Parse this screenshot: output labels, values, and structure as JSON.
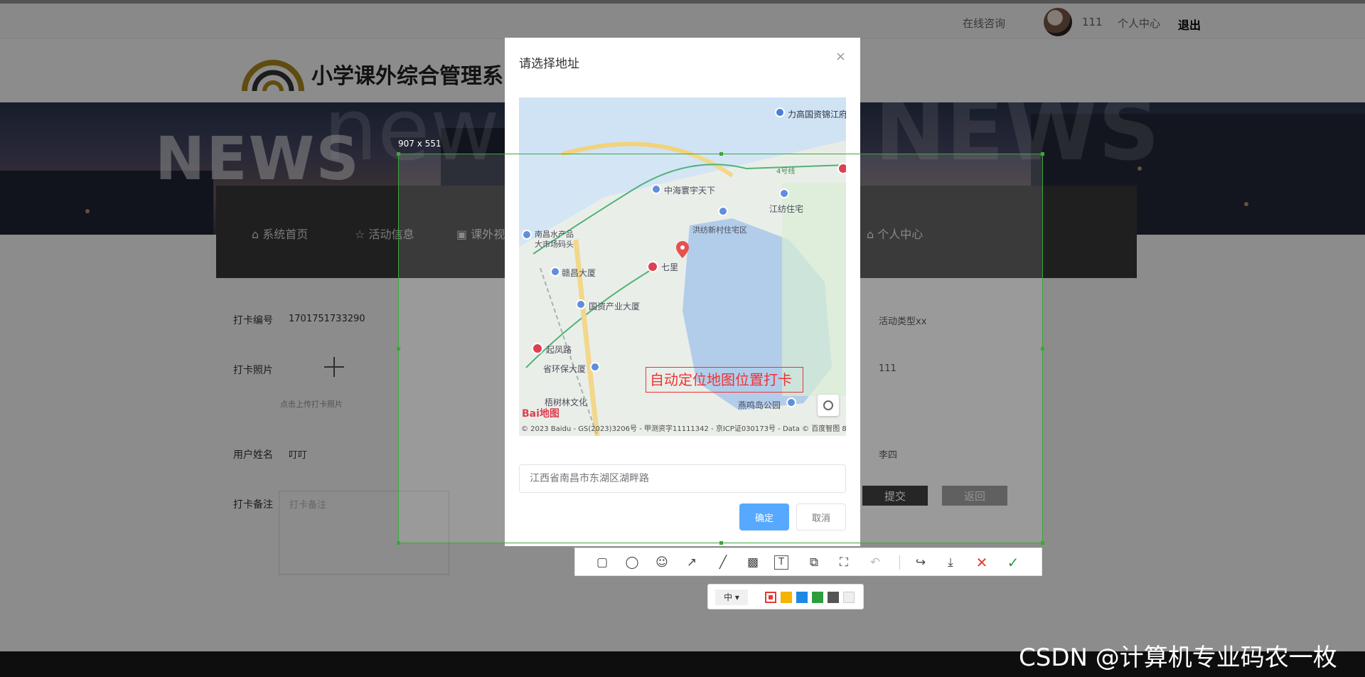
{
  "topbar": {
    "consult": "在线咨询",
    "username": "111",
    "user_center": "个人中心",
    "logout": "退出"
  },
  "site": {
    "title": "小学课外综合管理系"
  },
  "banner": {
    "word1": "NEWS",
    "word2": "new",
    "word3": "NEWS"
  },
  "nav": {
    "items": [
      {
        "icon": "home-icon",
        "label": "系统首页"
      },
      {
        "icon": "star-icon",
        "label": "活动信息"
      },
      {
        "icon": "bag-icon",
        "label": "课外视"
      },
      {
        "icon": "home-icon",
        "label": "个人中心"
      }
    ]
  },
  "form": {
    "card_no_label": "打卡编号",
    "card_no_value": "1701751733290",
    "photo_label": "打卡照片",
    "photo_hint": "点击上传打卡照片",
    "user_label": "用户姓名",
    "user_value": "叮叮",
    "note_label": "打卡备注",
    "note_placeholder": "打卡备注",
    "activity_type": "活动类型xx",
    "right_value2": "111",
    "right_value3": "李四",
    "submit": "提交",
    "back": "返回"
  },
  "modal": {
    "title": "请选择地址",
    "close": "×",
    "address": "江西省南昌市东湖区湖畔路",
    "ok": "确定",
    "cancel": "取消"
  },
  "map": {
    "pois": [
      "力高国资锦江府",
      "中海寰宇天下",
      "江纺住宅",
      "南昌水产品",
      "大市场码头",
      "洪纺新村住宅区",
      "七里",
      "赣昌大厦",
      "国资产业大厦",
      "起凤路",
      "省环保大厦",
      "燕鸣岛公园",
      "梧树林文化",
      "4号线"
    ],
    "attribution": "© 2023 Baidu - GS(2023)3206号 - 甲测资字11111342 - 京ICP证030173号 - Data © 百度智图 8",
    "logo": "Bai地图"
  },
  "screenshot": {
    "size_label": "907 x 551",
    "annotation": "自动定位地图位置打卡",
    "size_select": "中",
    "colors": [
      "#e53935",
      "#f4b400",
      "#1e88e5",
      "#2e9e3a",
      "#555555",
      "#eeeeee"
    ]
  },
  "watermark": "CSDN @计算机专业码农一枚"
}
